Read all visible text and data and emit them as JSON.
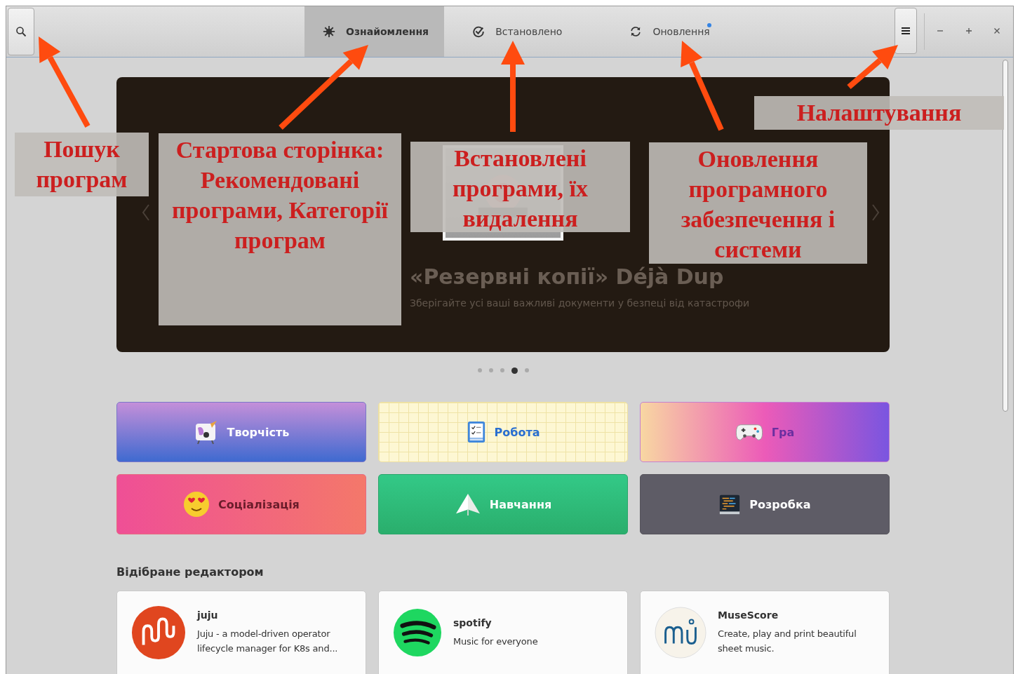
{
  "header": {
    "tabs": [
      {
        "label": "Ознайомлення",
        "kind": "explore",
        "selected": true,
        "badge": false
      },
      {
        "label": "Встановлено",
        "kind": "installed",
        "selected": false,
        "badge": false
      },
      {
        "label": "Оновлення",
        "kind": "updates",
        "selected": false,
        "badge": true
      }
    ]
  },
  "banner": {
    "title": "«Резервні копії» Déjà Dup",
    "subtitle": "Зберігайте усі ваші важливі документи у безпеці від катастрофи",
    "pages": [
      {
        "selected": false
      },
      {
        "selected": false
      },
      {
        "selected": false
      },
      {
        "selected": true
      },
      {
        "selected": false
      }
    ]
  },
  "categories": [
    {
      "label": "Творчість",
      "kind": "creative"
    },
    {
      "label": "Робота",
      "kind": "office"
    },
    {
      "label": "Гра",
      "kind": "games"
    },
    {
      "label": "Соціалізація",
      "kind": "social"
    },
    {
      "label": "Навчання",
      "kind": "education"
    },
    {
      "label": "Розробка",
      "kind": "development"
    }
  ],
  "featured": {
    "title": "Відібране редактором",
    "apps": [
      {
        "name": "juju",
        "description": "Juju - a model-driven operator lifecycle manager for K8s and...",
        "kind": "juju"
      },
      {
        "name": "spotify",
        "description": "Music for everyone",
        "kind": "spotify"
      },
      {
        "name": "MuseScore",
        "description": "Create, play and print beautiful sheet music.",
        "kind": "musescore"
      }
    ]
  },
  "annotations": [
    {
      "text": "Пошук\nпрограм"
    },
    {
      "text": "Стартова сторінка:\nРекомендовані\nпрограми, Категорії\nпрограм"
    },
    {
      "text": "Встановлені\nпрограми, їх\nвидалення"
    },
    {
      "text": "Оновлення\nпрограмного\nзабезпечення і\nсистеми"
    },
    {
      "text": "Налаштування"
    }
  ]
}
